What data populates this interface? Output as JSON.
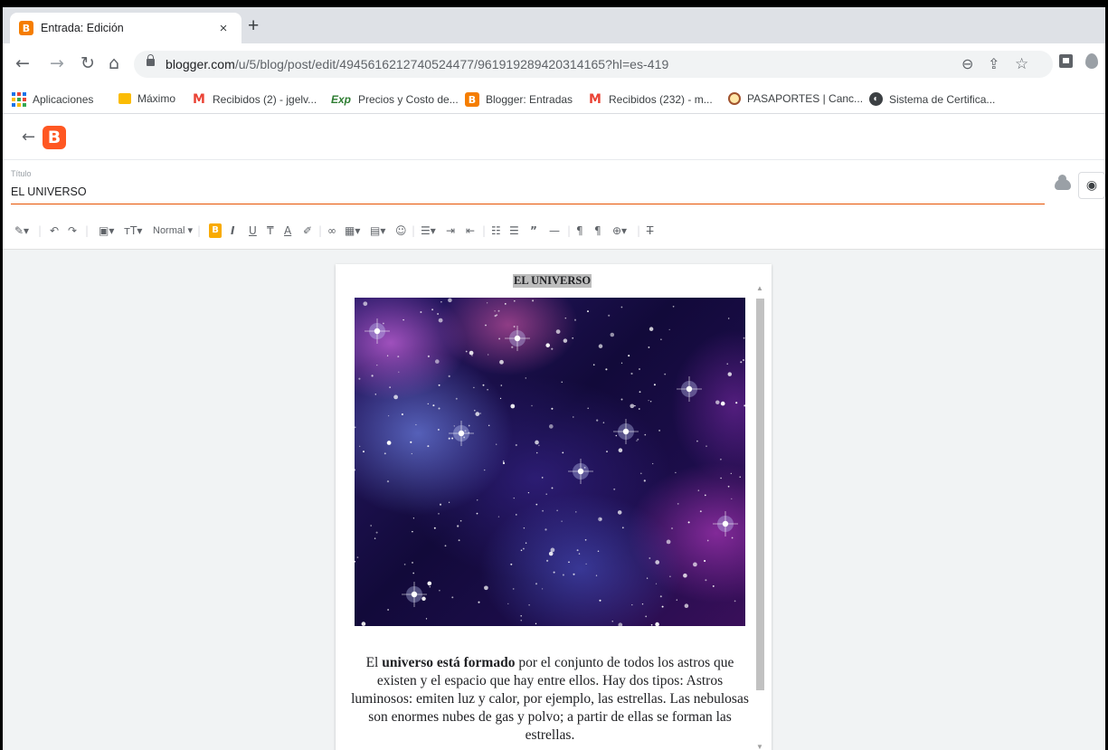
{
  "browser": {
    "tab_title": "Entrada: Edición",
    "tab_close": "×",
    "new_tab": "+",
    "url_host": "blogger.com",
    "url_path": "/u/5/blog/post/edit/4945616212740524477/961919289420314165?hl=es-419"
  },
  "bookmarks": [
    {
      "label": "Aplicaciones",
      "icon": "apps-grid-icon"
    },
    {
      "label": "Máximo",
      "icon": "folder-icon"
    },
    {
      "label": "Recibidos (2) - jgelv...",
      "icon": "gmail-icon"
    },
    {
      "label": "Precios y Costo de...",
      "icon": "exp-icon",
      "icon_text": "Exp"
    },
    {
      "label": "Blogger: Entradas",
      "icon": "blogger-icon",
      "icon_text": "B"
    },
    {
      "label": "Recibidos (232) - m...",
      "icon": "gmail-icon"
    },
    {
      "label": "PASAPORTES | Canc...",
      "icon": "seal-icon"
    },
    {
      "label": "Sistema de Certifica...",
      "icon": "globe-icon"
    }
  ],
  "editor": {
    "title_label": "Título",
    "title_value": "EL UNIVERSO",
    "format_normal": "Normal",
    "format_bold": "B"
  },
  "post": {
    "heading": "EL UNIVERSO",
    "body_before": "El ",
    "body_bold": "universo está formado",
    "body_after": " por el conjunto de todos los astros que existen y el espacio que hay entre ellos. Hay dos tipos: Astros luminosos: emiten luz y calor, por ejemplo, las estrellas. Las nebulosas son enormes nubes de gas y polvo; a partir de ellas se forman las estrellas."
  },
  "colors": {
    "blogger_orange": "#ff5722",
    "title_underline": "#e65100",
    "tab_strip": "#dee1e6"
  }
}
